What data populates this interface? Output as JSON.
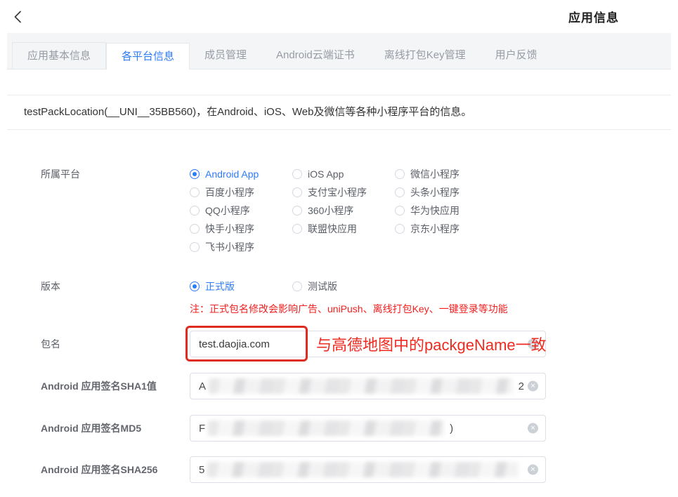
{
  "topbar": {
    "title": "应用信息"
  },
  "tabs": [
    {
      "key": "app-basic-info",
      "label": "应用基本信息",
      "active": false,
      "boxed": true
    },
    {
      "key": "platform-info",
      "label": "各平台信息",
      "active": true,
      "boxed": false
    },
    {
      "key": "member-management",
      "label": "成员管理",
      "active": false,
      "boxed": false
    },
    {
      "key": "android-cloud-cert",
      "label": "Android云端证书",
      "active": false,
      "boxed": false
    },
    {
      "key": "offline-pack-key",
      "label": "离线打包Key管理",
      "active": false,
      "boxed": false
    },
    {
      "key": "user-feedback",
      "label": "用户反馈",
      "active": false,
      "boxed": false
    }
  ],
  "summary": "testPackLocation(__UNI__35BB560)，在Android、iOS、Web及微信等各种小程序平台的信息。",
  "form": {
    "platform": {
      "label": "所属平台",
      "options": [
        {
          "key": "android-app",
          "label": "Android App",
          "selected": true
        },
        {
          "key": "ios-app",
          "label": "iOS App",
          "selected": false
        },
        {
          "key": "wechat-mp",
          "label": "微信小程序",
          "selected": false
        },
        {
          "key": "baidu-mp",
          "label": "百度小程序",
          "selected": false
        },
        {
          "key": "alipay-mp",
          "label": "支付宝小程序",
          "selected": false
        },
        {
          "key": "toutiao-mp",
          "label": "头条小程序",
          "selected": false
        },
        {
          "key": "qq-mp",
          "label": "QQ小程序",
          "selected": false
        },
        {
          "key": "360-mp",
          "label": "360小程序",
          "selected": false
        },
        {
          "key": "huawei-quickapp",
          "label": "华为快应用",
          "selected": false
        },
        {
          "key": "kuaishou-mp",
          "label": "快手小程序",
          "selected": false
        },
        {
          "key": "union-quickapp",
          "label": "联盟快应用",
          "selected": false
        },
        {
          "key": "jd-mp",
          "label": "京东小程序",
          "selected": false
        },
        {
          "key": "feishu-mp",
          "label": "飞书小程序",
          "selected": false
        }
      ]
    },
    "version": {
      "label": "版本",
      "options": [
        {
          "key": "release",
          "label": "正式版",
          "selected": true
        },
        {
          "key": "test",
          "label": "测试版",
          "selected": false
        }
      ],
      "note": "注：正式包名修改会影响广告、uniPush、离线打包Key、一键登录等功能"
    },
    "package": {
      "label": "包名",
      "value": "test.daojia.com",
      "annotation": "与高德地图中的packgeName一致"
    },
    "sha1": {
      "label": "Android 应用签名SHA1值",
      "visible_prefix": "A",
      "visible_suffix": "2",
      "redacted": true
    },
    "md5": {
      "label": "Android 应用签名MD5",
      "visible_prefix": "F",
      "visible_suffix": ")",
      "redacted": true
    },
    "sha256": {
      "label": "Android 应用签名SHA256",
      "visible_prefix": "5",
      "visible_suffix": "",
      "redacted": true
    }
  },
  "colors": {
    "accent_blue": "#2e7bf6",
    "alert_red": "#f22020",
    "annotation_red": "#ee2b20",
    "tabstrip_bg": "#f4f5f7"
  }
}
